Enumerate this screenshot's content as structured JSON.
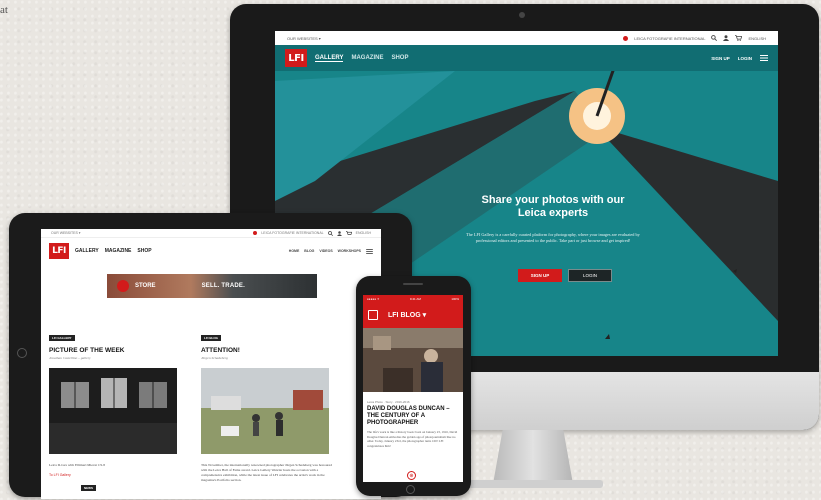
{
  "corner_text": "at",
  "desktop": {
    "topbar": {
      "our_websites": "OUR WEBSITES ▾",
      "site_name": "LEICA FOTOGRAFIE INTERNATIONAL",
      "language": "ENGLISH"
    },
    "logo": "LFI",
    "nav": [
      "GALLERY",
      "MAGAZINE",
      "SHOP"
    ],
    "signup_link": "SIGN UP",
    "login_link": "LOGIN",
    "hero_title": "Share your photos with our Leica experts",
    "hero_text": "The LFI Gallery is a carefully curated platform for photography, where your images are evaluated by professional editors and presented to the public. Take part or just browse and get inspired!",
    "btn_signup": "SIGN UP",
    "btn_login": "LOGIN",
    "colors": {
      "accent": "#d21b1b",
      "hero": "#177f84"
    }
  },
  "tablet": {
    "topbar": {
      "our_websites": "OUR WEBSITES ▾",
      "site_name": "LEICA FOTOGRAFIE INTERNATIONAL",
      "language": "ENGLISH"
    },
    "logo": "LFI",
    "nav": [
      "GALLERY",
      "MAGAZINE",
      "SHOP"
    ],
    "subnav": [
      "HOME",
      "BLOG",
      "VIDEOS",
      "WORKSHOPS"
    ],
    "banner": {
      "store": "STORE",
      "tagline": "SELL. TRADE."
    },
    "col1": {
      "tag": "LFI GALLERY",
      "title": "PICTURE OF THE WEEK",
      "author": "Jonathan Castellino – gallery",
      "caption": "Leica D-Lux with Ellimeri Mievet CS.8",
      "link": "To LFI Gallery"
    },
    "col2": {
      "tag": "LFI BLOG",
      "title": "ATTENTION!",
      "author": "Jürgen Schadeberg",
      "caption": "This November, the internationally renowned photographer Jürgen Schadeberg was honoured with the Leica Hall of Fame award. Leica Gallery Wetzlar hosts the occasion with a comprehensive exhibition, while the latest issue of LFI celebrates the artist's work in the magazine's Portfolio section."
    },
    "news_tag": "NEWS"
  },
  "phone": {
    "status_left": "●●●●● ✦",
    "status_time": "9:41 AM",
    "status_right": "100%",
    "title": "LFI BLOG ▾",
    "meta": "Leica Photo · Story · 2016-2016",
    "headline": "DAVID DOUGLAS DUNCAN – THE CENTURY OF A PHOTOGRAPHER",
    "body": "The life's work is like a history book: born on January 23, 1916, David Douglas Duncan embodies the golden age of photojournalism like no other. Today, January 23rd, the photographer turns 100! LFI congratulates him!",
    "more": "⊕"
  }
}
